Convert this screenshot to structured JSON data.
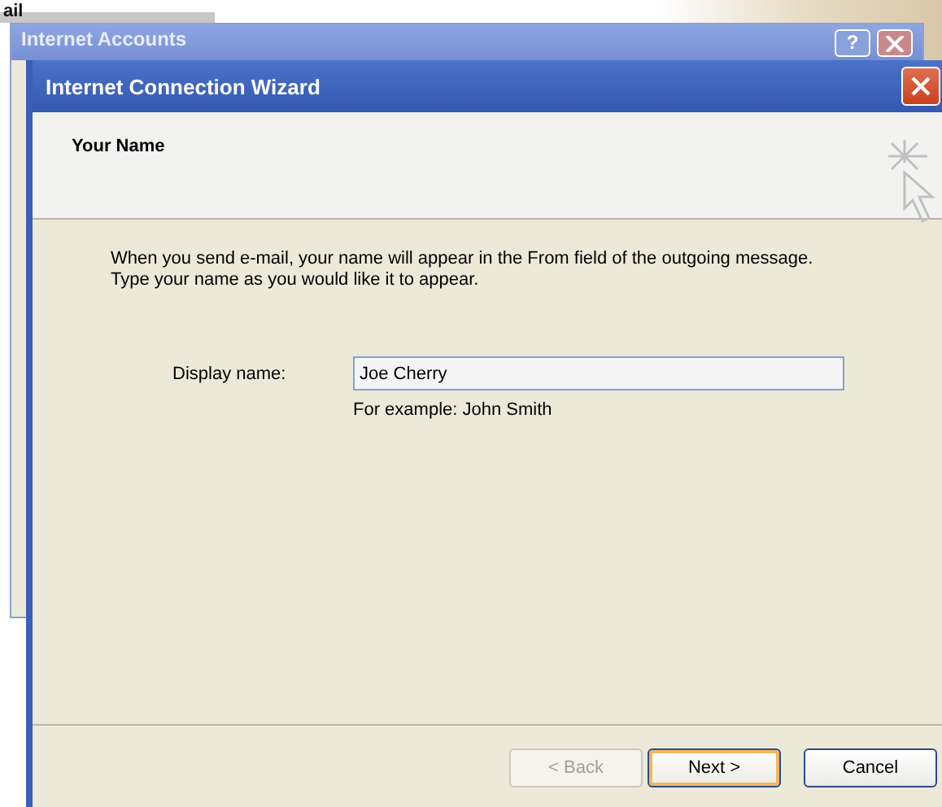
{
  "background_text": "ail",
  "background_window": {
    "title": "Internet Accounts",
    "help_button": "?"
  },
  "window": {
    "title": "Internet Connection Wizard"
  },
  "header": {
    "title": "Your Name"
  },
  "intro": [
    "When you send e-mail, your name will appear in the From field of the outgoing message.",
    "Type your name as you would like it to appear."
  ],
  "display_name": {
    "label": "Display name:",
    "value": "Joe Cherry",
    "example": "For example: John Smith"
  },
  "buttons": [
    {
      "label": "< Back",
      "disabled": true,
      "default": false
    },
    {
      "label": "Next >",
      "disabled": false,
      "default": true
    },
    {
      "label": "Cancel",
      "disabled": false,
      "default": false
    }
  ]
}
